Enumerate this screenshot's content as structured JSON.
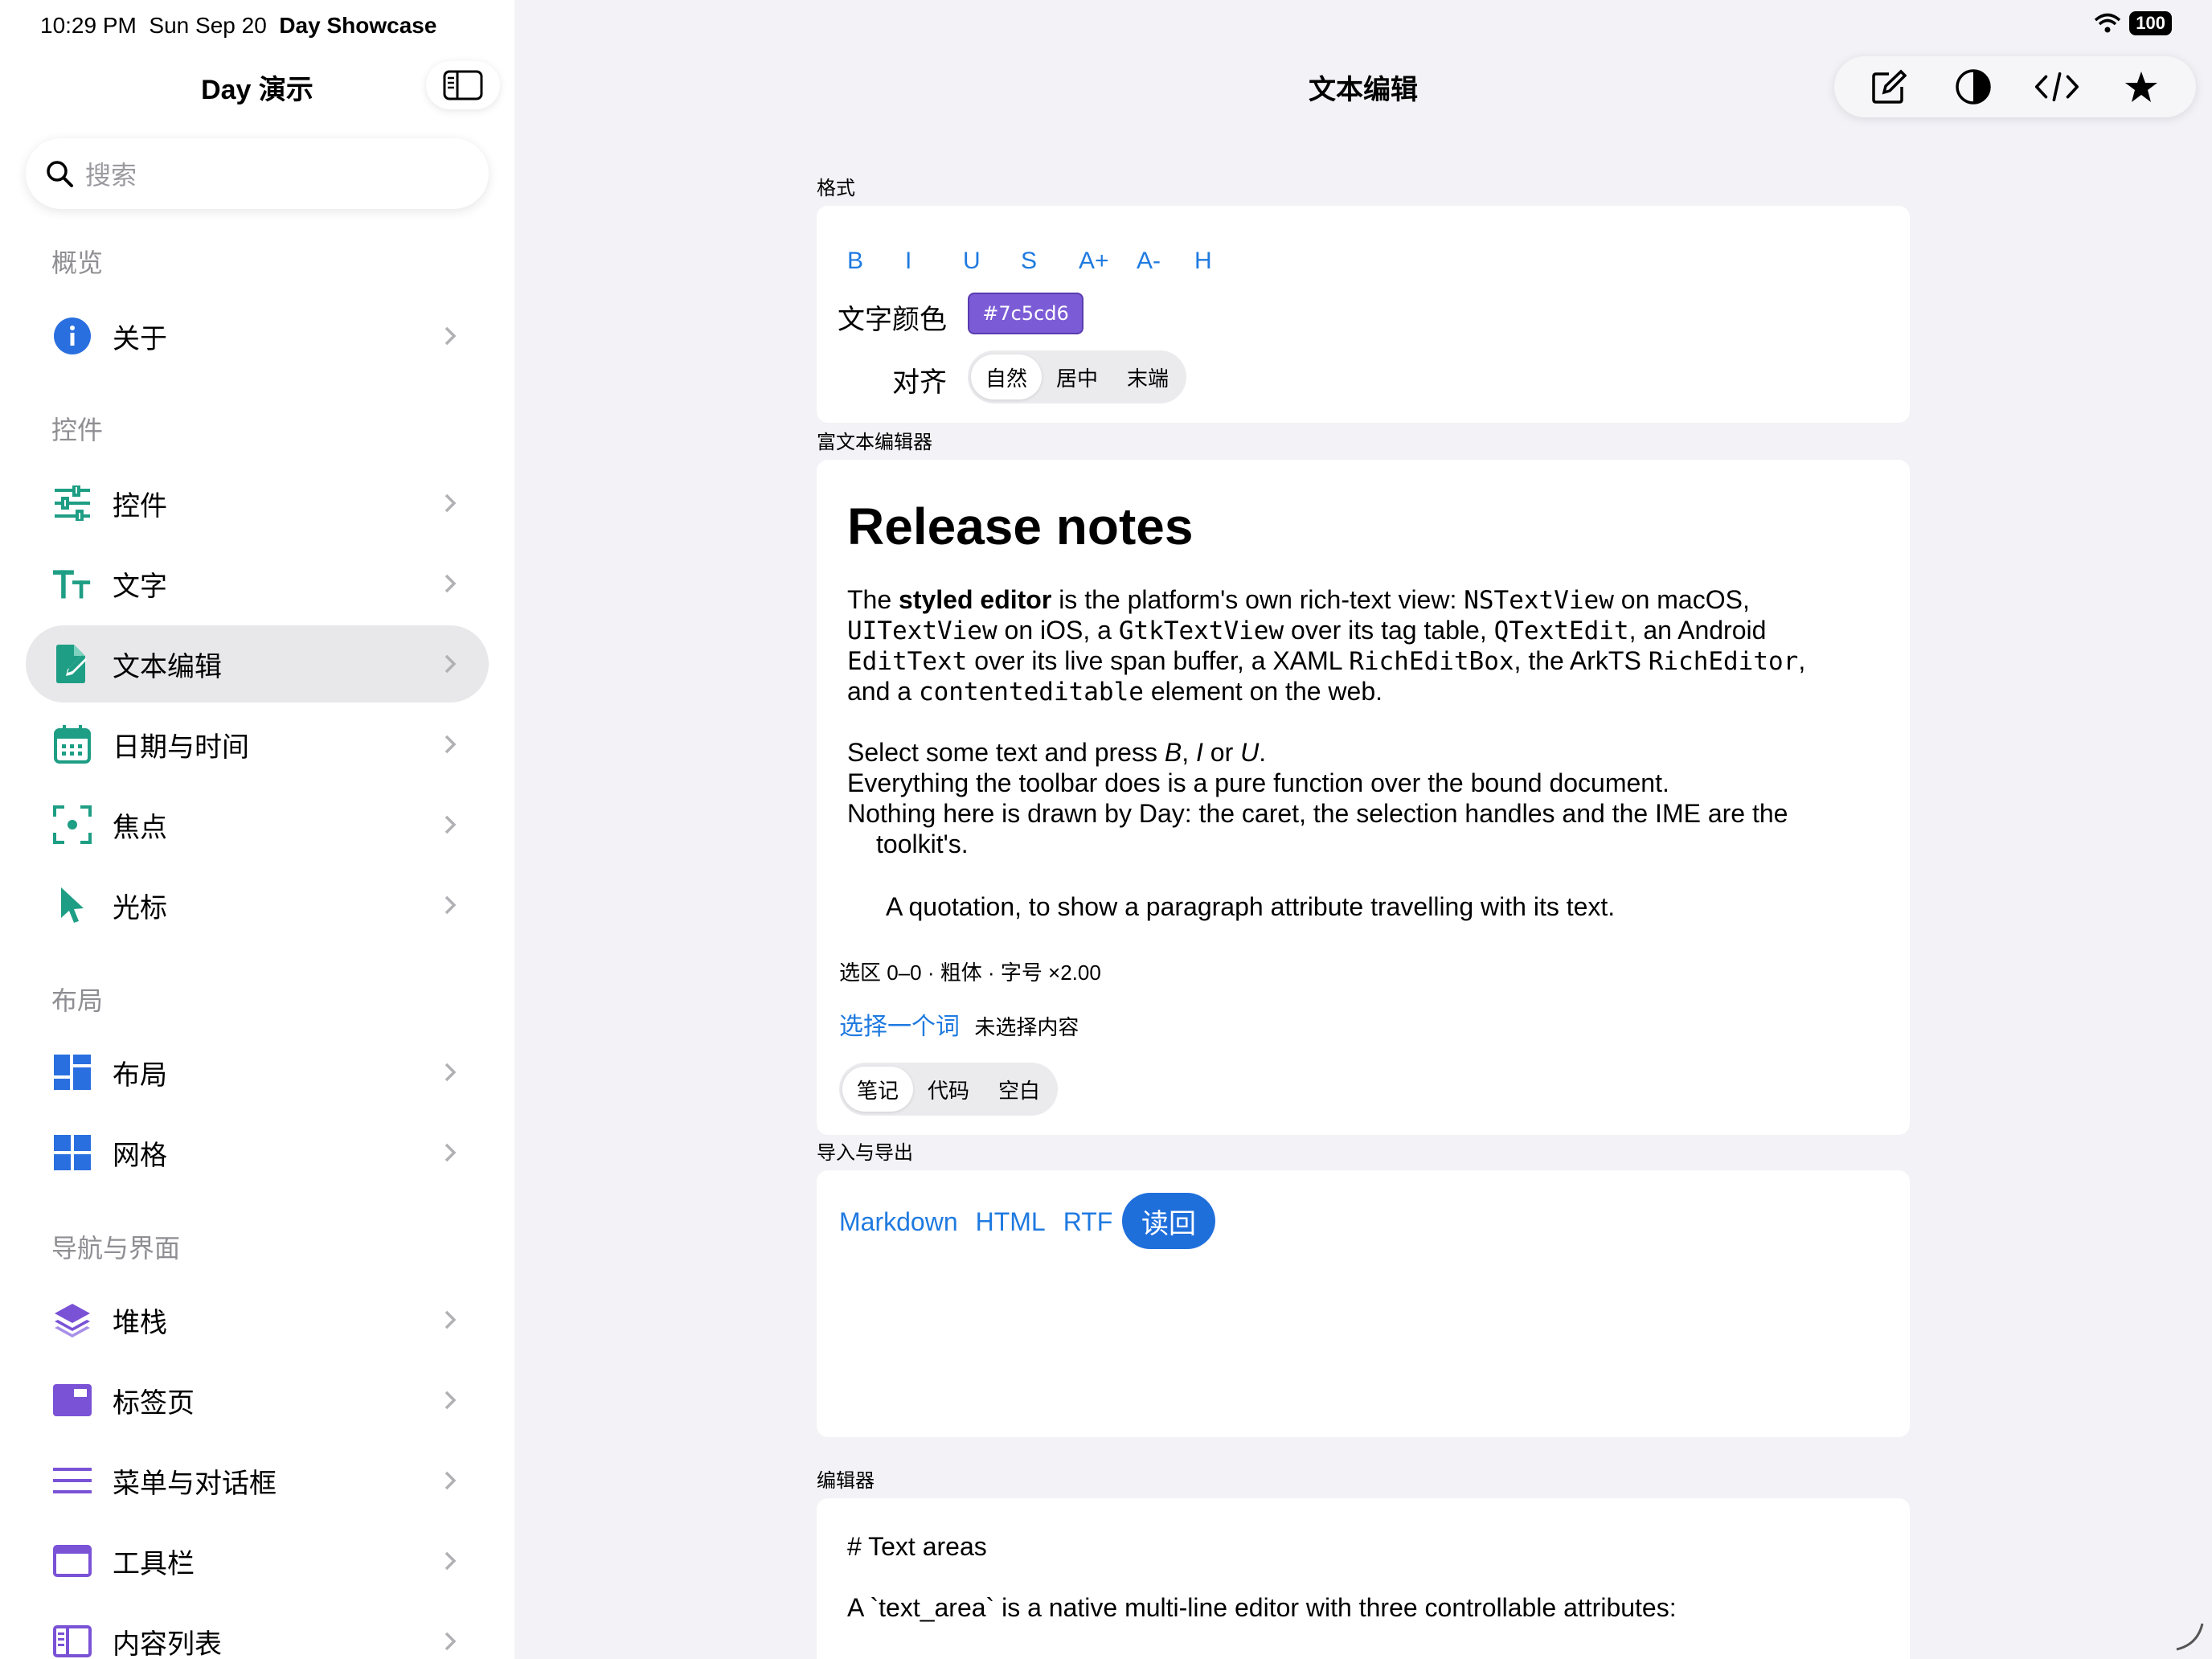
{
  "status": {
    "time": "10:29 PM",
    "date": "Sun Sep 20",
    "app": "Day Showcase",
    "battery": "100"
  },
  "sidebar": {
    "title": "Day 演示",
    "search_placeholder": "搜索",
    "sections": [
      {
        "title": "概览",
        "items": [
          {
            "label": "关于",
            "icon": "info-icon",
            "color": "#2a6fe0"
          }
        ]
      },
      {
        "title": "控件",
        "items": [
          {
            "label": "控件",
            "icon": "sliders-icon",
            "color": "#1e9e84"
          },
          {
            "label": "文字",
            "icon": "text-size-icon",
            "color": "#1e9e84"
          },
          {
            "label": "文本编辑",
            "icon": "edit-document-icon",
            "color": "#1e9e84",
            "selected": true
          },
          {
            "label": "日期与时间",
            "icon": "calendar-icon",
            "color": "#1e9e84"
          },
          {
            "label": "焦点",
            "icon": "focus-icon",
            "color": "#1e9e84"
          },
          {
            "label": "光标",
            "icon": "cursor-icon",
            "color": "#1e9e84"
          }
        ]
      },
      {
        "title": "布局",
        "items": [
          {
            "label": "布局",
            "icon": "layout-icon",
            "color": "#2a6fe0"
          },
          {
            "label": "网格",
            "icon": "grid-icon",
            "color": "#2a6fe0"
          }
        ]
      },
      {
        "title": "导航与界面",
        "items": [
          {
            "label": "堆栈",
            "icon": "stack-icon",
            "color": "#7a52d6"
          },
          {
            "label": "标签页",
            "icon": "tabs-icon",
            "color": "#7a52d6"
          },
          {
            "label": "菜单与对话框",
            "icon": "menu-icon",
            "color": "#7a52d6"
          },
          {
            "label": "工具栏",
            "icon": "toolbar-icon",
            "color": "#7a52d6"
          },
          {
            "label": "内容列表",
            "icon": "content-list-icon",
            "color": "#7a52d6"
          }
        ]
      }
    ]
  },
  "main": {
    "title": "文本编辑",
    "toolbar": [
      "compose-icon",
      "contrast-icon",
      "code-icon",
      "star-icon"
    ],
    "format": {
      "caption": "格式",
      "buttons": [
        "B",
        "I",
        "U",
        "S",
        "A+",
        "A-",
        "H"
      ],
      "color_label": "文字颜色",
      "color_value": "#7c5cd6",
      "align_label": "对齐",
      "align_options": [
        "自然",
        "居中",
        "末端"
      ],
      "align_selected": "自然"
    },
    "rich": {
      "caption": "富文本编辑器",
      "heading": "Release notes",
      "p1": {
        "t1": "The ",
        "bold": "styled editor",
        "t2": " is the platform's own rich-text view: ",
        "c1": "NSTextView",
        "t3": " on macOS,",
        "c2": "UITextView",
        "t4": " on iOS, a ",
        "c3": "GtkTextView",
        "t5": " over its tag table, ",
        "c4": "QTextEdit",
        "t6": ", an Android",
        "c5": "EditText",
        "t7": " over its live span buffer, a XAML ",
        "c6": "RichEditBox",
        "t8": ", the ArkTS ",
        "c7": "RichEditor",
        "t9": ",",
        "t10": "and a ",
        "c8": "contenteditable",
        "t11": " element on the web."
      },
      "p2": {
        "t1": "Select some text and press ",
        "i1": "B",
        "t2": ", ",
        "i2": "I",
        "t3": " or ",
        "i3": "U",
        "t4": "."
      },
      "p3": "Everything the toolbar does is a pure function over the bound document.",
      "p4a": "Nothing here is drawn by Day: the caret, the selection handles and the IME are the",
      "p4b": "toolkit's.",
      "quote": "A quotation, to show a paragraph attribute travelling with its text.",
      "selection_info": "选区 0–0 · 粗体 · 字号 ×2.00",
      "select_word_link": "选择一个词",
      "no_selection": "未选择内容",
      "doc_options": [
        "笔记",
        "代码",
        "空白"
      ],
      "doc_selected": "笔记"
    },
    "export": {
      "caption": "导入与导出",
      "links": [
        "Markdown",
        "HTML",
        "RTF"
      ],
      "readback": "读回"
    },
    "editor": {
      "caption": "编辑器",
      "line1": "# Text areas",
      "line2": "A `text_area` is a native multi-line editor with three controllable attributes:"
    }
  }
}
